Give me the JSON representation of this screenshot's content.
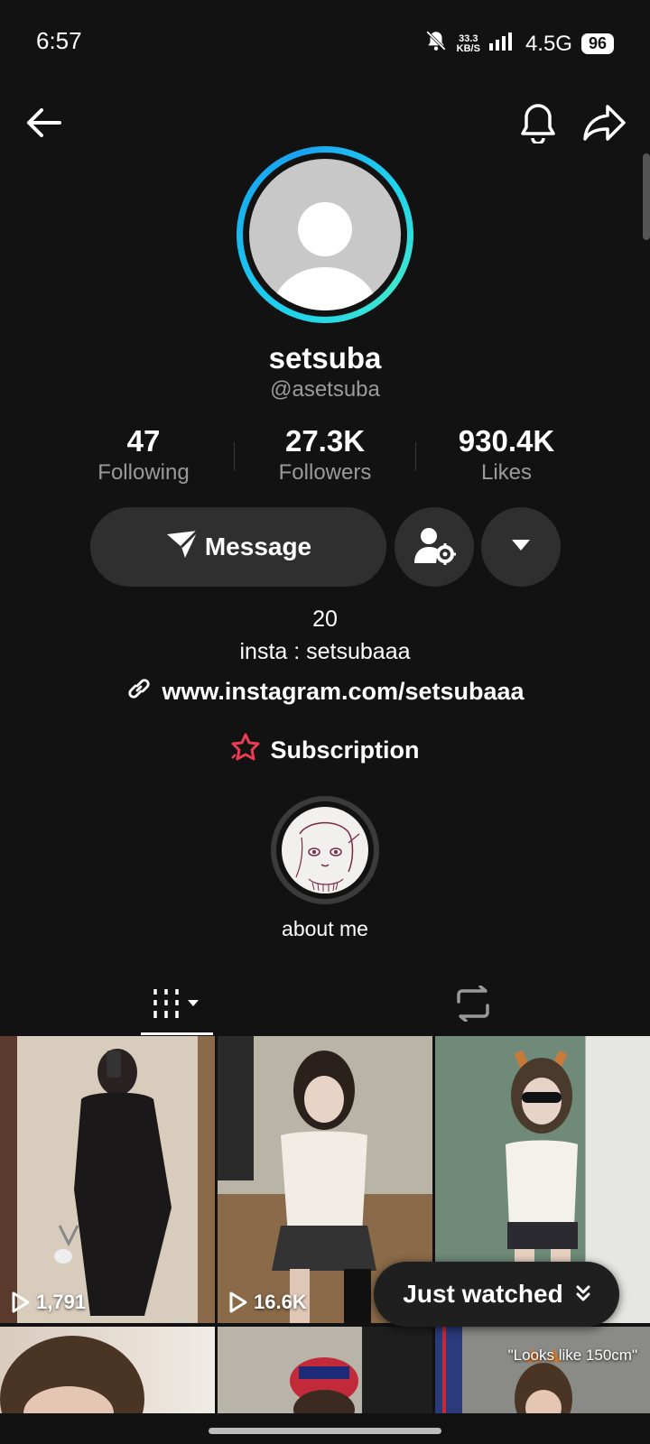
{
  "status_bar": {
    "time": "6:57",
    "net_speed_top": "33.3",
    "net_speed_bottom": "KB/S",
    "network": "4.5G",
    "battery": "96",
    "icons": [
      "mute-bell-icon",
      "signal-icon"
    ]
  },
  "header": {
    "icons": [
      "back-arrow-icon",
      "notification-bell-icon",
      "share-icon"
    ]
  },
  "profile": {
    "name": "setsuba",
    "handle": "@asetsuba",
    "stats": [
      {
        "value": "47",
        "label": "Following"
      },
      {
        "value": "27.3K",
        "label": "Followers"
      },
      {
        "value": "930.4K",
        "label": "Likes"
      }
    ],
    "message_label": "Message",
    "bio_lines": [
      "20",
      "insta : setsubaaa"
    ],
    "link": "www.instagram.com/setsubaaa",
    "subscription_label": "Subscription",
    "highlight_label": "about me"
  },
  "tabs": {
    "icons": [
      "videos-grid-icon",
      "reposts-icon"
    ]
  },
  "videos": [
    {
      "views": "1,791"
    },
    {
      "views": "16.6K"
    },
    {
      "views": ""
    },
    {
      "views": "",
      "caption": ""
    },
    {
      "views": "",
      "caption": ""
    },
    {
      "views": "",
      "caption": "\"Looks like 150cm\""
    }
  ],
  "just_watched_label": "Just watched",
  "colors": {
    "background": "#121212",
    "button": "#2f2f2f",
    "accent_ring": "#20d5ec",
    "subscription_red": "#ee3b54"
  }
}
